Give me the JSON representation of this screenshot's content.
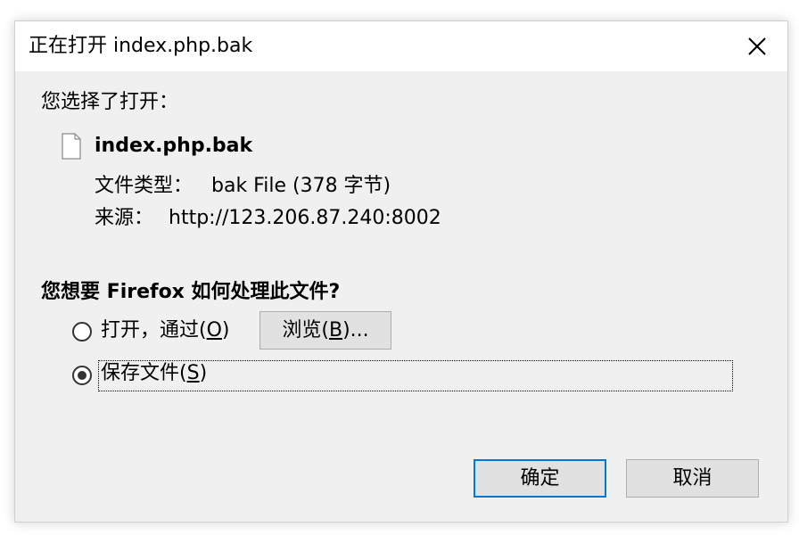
{
  "dialog": {
    "title": "正在打开 index.php.bak",
    "intro": "您选择了打开：",
    "file": {
      "name": "index.php.bak",
      "type_label": "文件类型：",
      "type_value": "bak File (378 字节)",
      "source_label": "来源：",
      "source_value": "http://123.206.87.240:8002"
    },
    "question": "您想要 Firefox 如何处理此文件?",
    "option_open": {
      "prefix": "打开，通过(",
      "hotkey": "O",
      "suffix": ")",
      "selected": false
    },
    "browse": {
      "prefix": "浏览(",
      "hotkey": "B",
      "suffix": ")..."
    },
    "option_save": {
      "prefix": "保存文件(",
      "hotkey": "S",
      "suffix": ")",
      "selected": true
    },
    "ok_label": "确定",
    "cancel_label": "取消"
  },
  "icons": {
    "close": "close-icon",
    "file": "file-icon",
    "radio_checked": "radio-checked-icon",
    "radio_unchecked": "radio-unchecked-icon"
  },
  "colors": {
    "dialog_bg": "#f0f0f0",
    "titlebar_bg": "#ffffff",
    "button_bg": "#e1e1e1",
    "focus_border": "#0078d7"
  }
}
